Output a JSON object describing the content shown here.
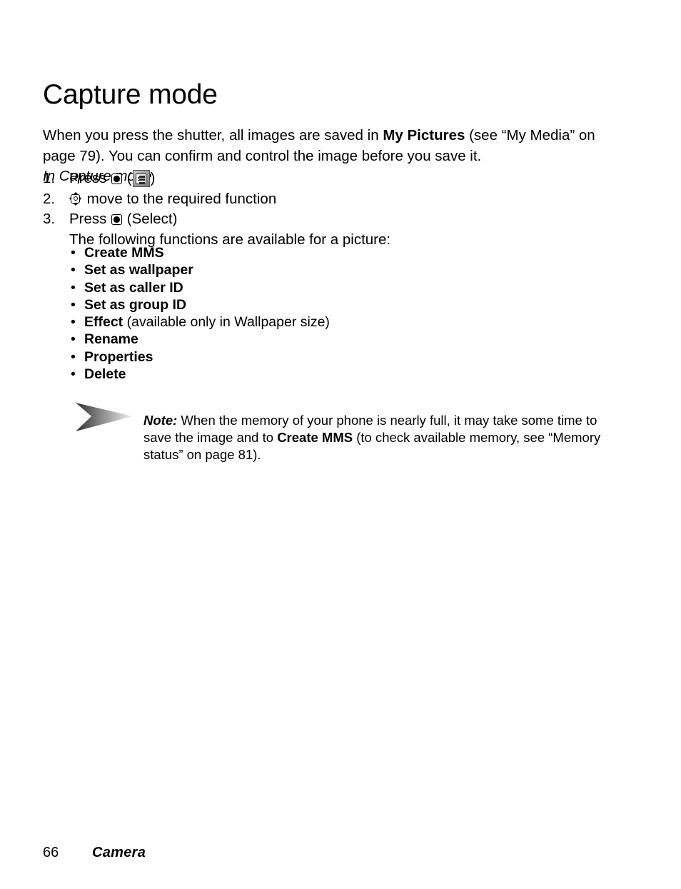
{
  "document": {
    "title": "Capture mode"
  },
  "intro": {
    "part1": "When you press the shutter, all images are saved in ",
    "bold1": "My Pictures",
    "part2": " (see “My Media” on page 79). You can confirm and control the image before you save it.",
    "subhead": "In Capture mode"
  },
  "steps": [
    {
      "number": "1.",
      "text_before": "Press ",
      "icon_select": "select-key-icon",
      "text_middle": " (",
      "icon_menu": "menu-key-icon",
      "text_after": ")"
    },
    {
      "number": "2.",
      "icon_nav": "navigation-key-icon",
      "text_after": " move to the required function"
    },
    {
      "number": "3.",
      "text_before": "Press ",
      "icon_select": "select-key-icon",
      "text_after": " (Select)",
      "sub_text": "The following functions are available for a picture:"
    }
  ],
  "functions": {
    "bullet": "•",
    "items": [
      {
        "name": "Create MMS",
        "note": ""
      },
      {
        "name": "Set as wallpaper",
        "note": ""
      },
      {
        "name": "Set as caller ID",
        "note": ""
      },
      {
        "name": "Set as group ID",
        "note": ""
      },
      {
        "name": "Effect",
        "note": " (available only in Wallpaper size)"
      },
      {
        "name": "Rename",
        "note": ""
      },
      {
        "name": "Properties",
        "note": ""
      },
      {
        "name": "Delete",
        "note": ""
      }
    ]
  },
  "note": {
    "icon": "note-arrow-icon",
    "label": "Note:",
    "part1": " When the memory of your phone is nearly full, it may take some time to save the image and to ",
    "bold1": "Create MMS",
    "part2": " (to check available memory, see “Memory status” on page 81)."
  },
  "footer": {
    "page_number": "66",
    "section": "Camera"
  },
  "colors": {
    "text": "#000000",
    "background": "#ffffff",
    "key_gray_light": "#cfcfcf",
    "key_gray_dark": "#7c7c7c",
    "arrow_dark": "#3a3a3a",
    "arrow_light": "#eeeeee"
  }
}
